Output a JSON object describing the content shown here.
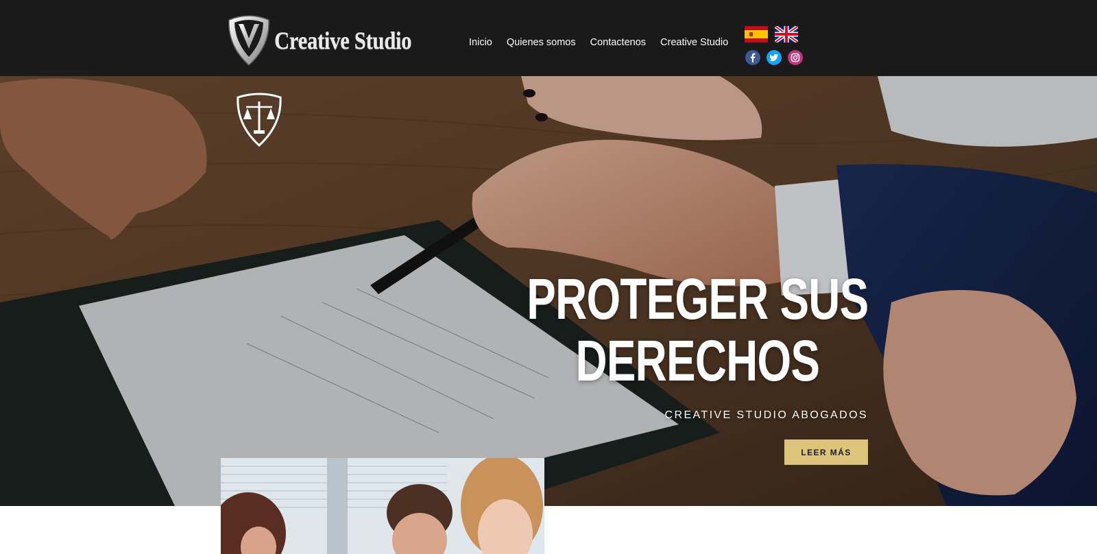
{
  "header": {
    "brand_name": "Creative Studio",
    "logo_icon": "v-shield-logo",
    "nav": [
      {
        "label": "Inicio"
      },
      {
        "label": "Quienes somos"
      },
      {
        "label": "Contactenos"
      },
      {
        "label": "Creative Studio"
      }
    ],
    "languages": [
      {
        "icon": "spain-flag-icon"
      },
      {
        "icon": "uk-flag-icon"
      }
    ],
    "socials": [
      {
        "icon": "facebook-icon",
        "color": "#3b5998"
      },
      {
        "icon": "twitter-icon",
        "color": "#1da1f2"
      },
      {
        "icon": "instagram-icon",
        "color": "#c13584"
      }
    ]
  },
  "hero": {
    "emblem_icon": "scales-of-justice-shield-icon",
    "title_line1": "PROTEGER SUS",
    "title_line2": "DERECHOS",
    "subtitle": "CREATIVE STUDIO ABOGADOS",
    "cta_label": "LEER MÁS",
    "cta_color": "#dcc57b"
  },
  "colors": {
    "header_bg": "#1a1a1a",
    "text_light": "#ffffff",
    "accent_gold": "#dcc57b"
  }
}
